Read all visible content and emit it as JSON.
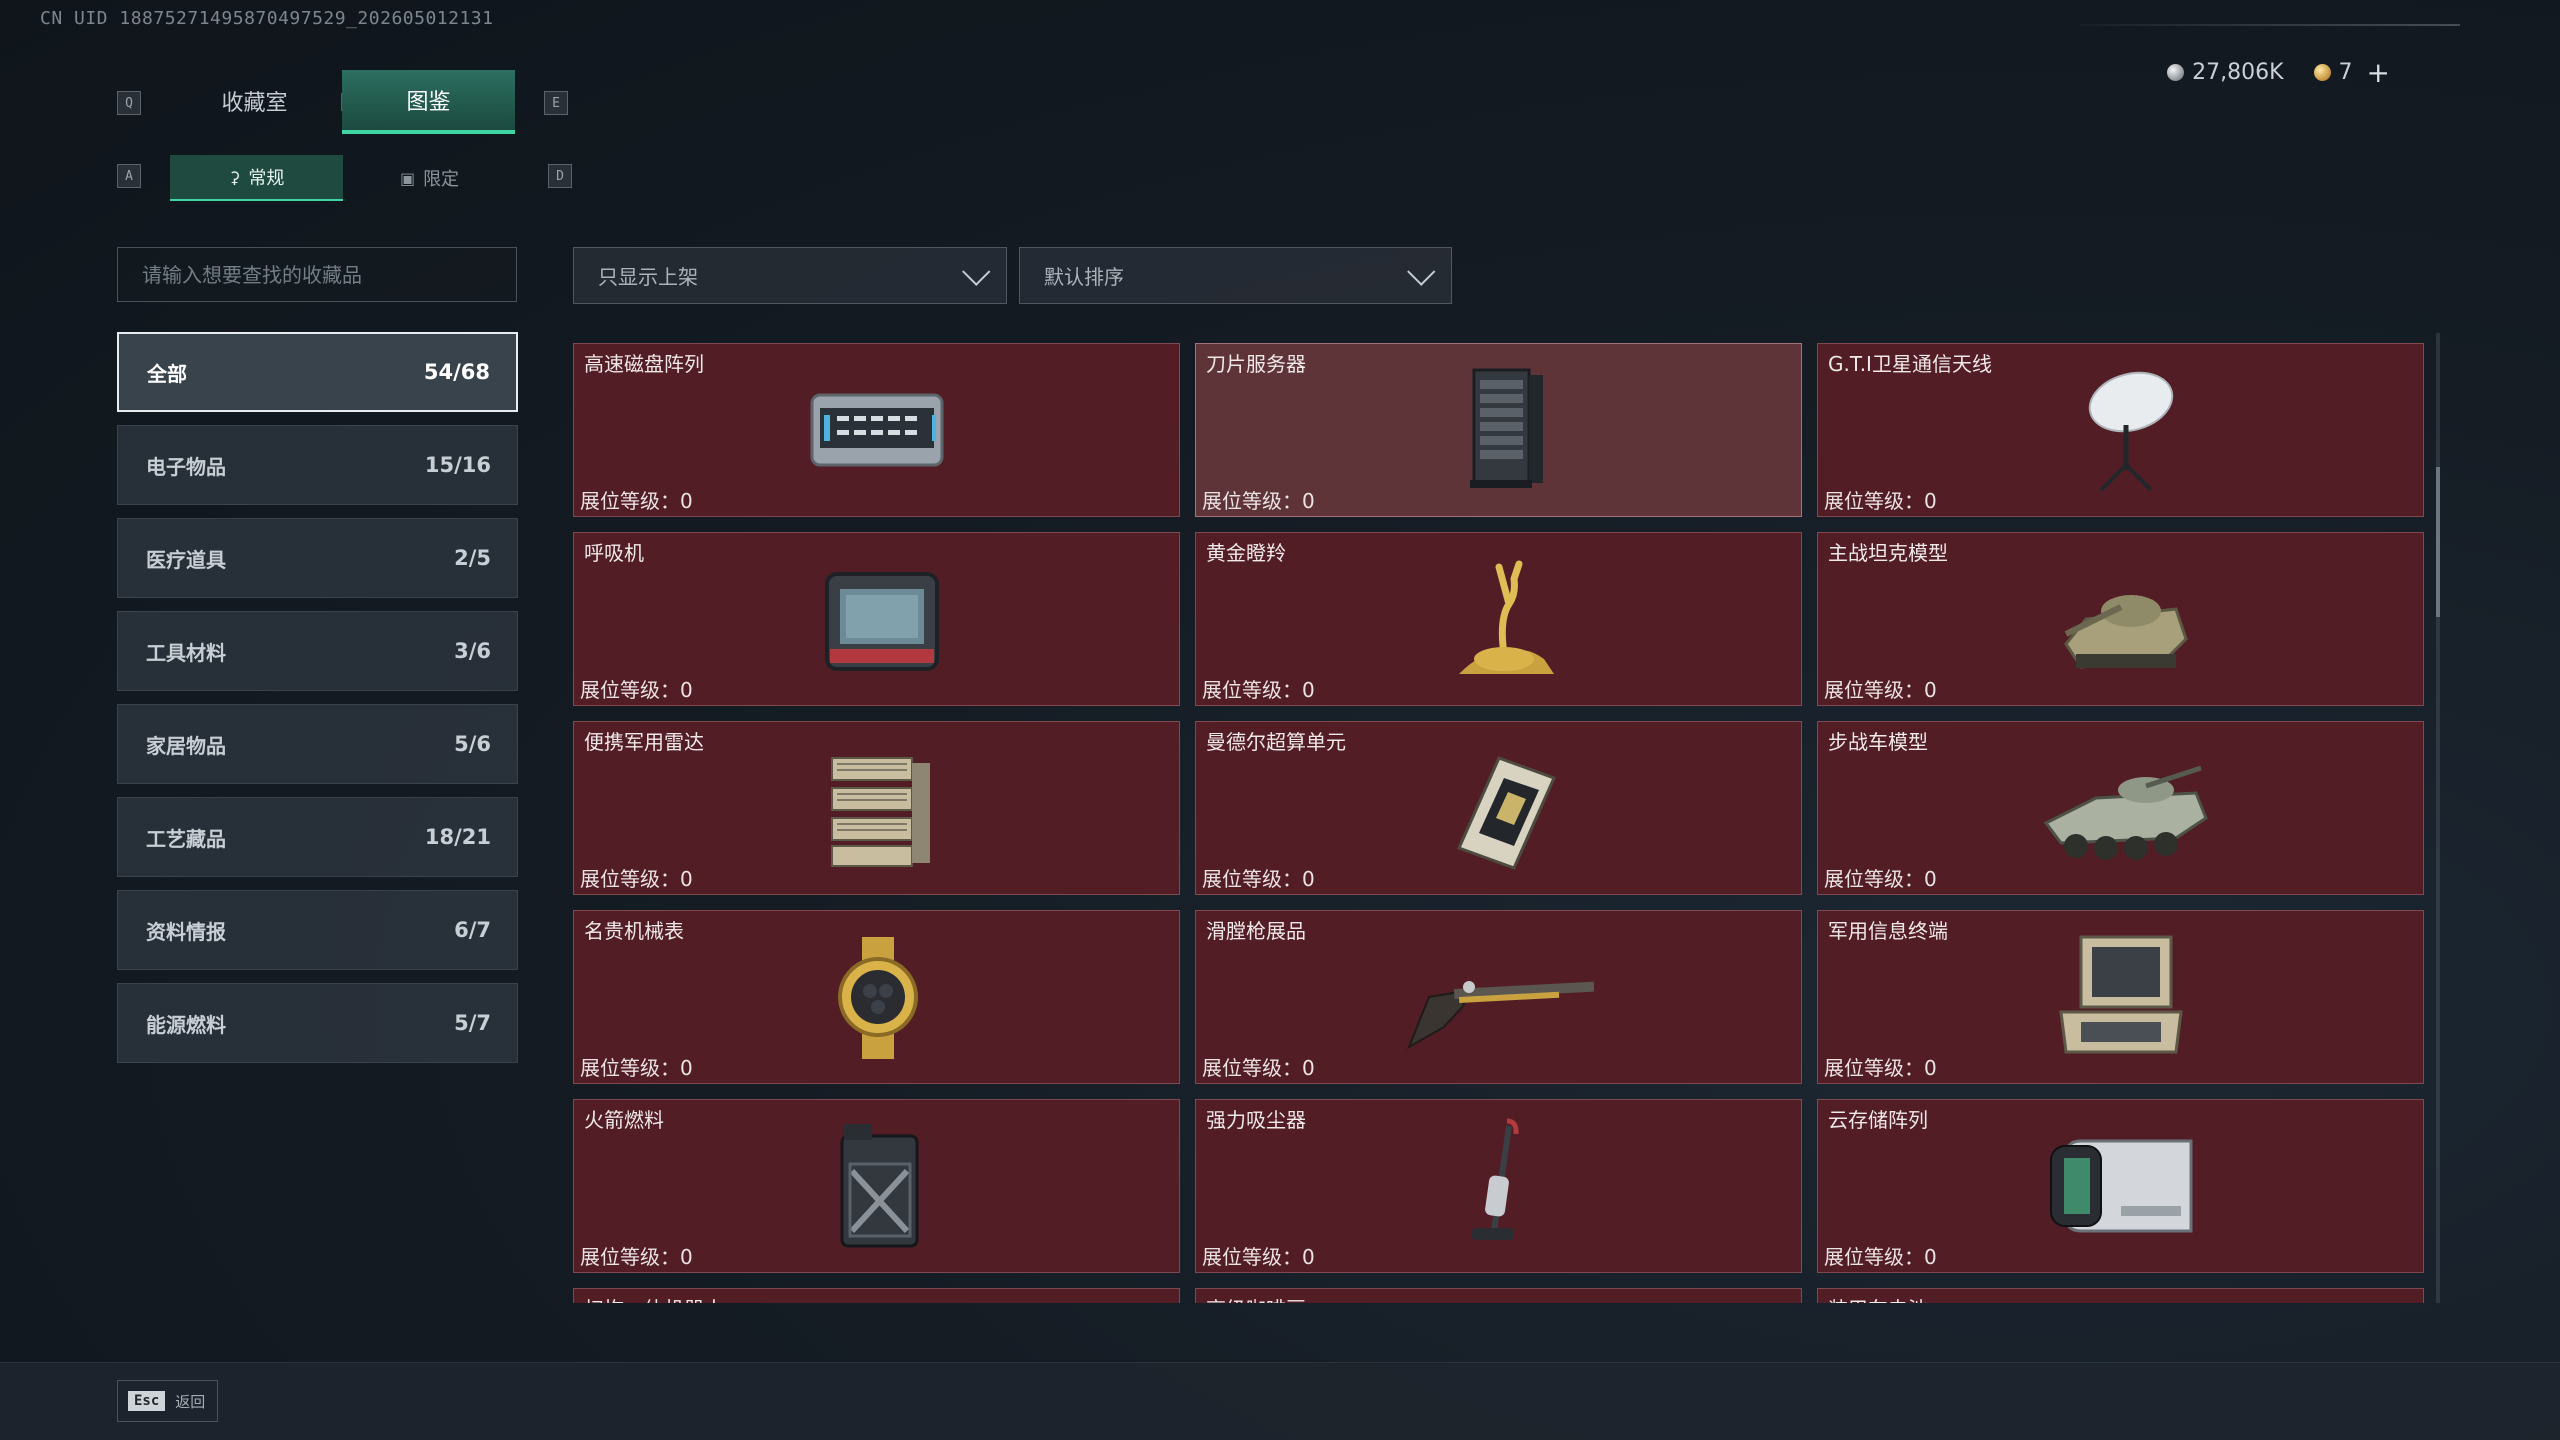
{
  "header": {
    "uid_text": "CN UID 18875271495870497529_202605012131",
    "currency": [
      {
        "icon": "silver-coin-icon",
        "value": "27,806K"
      },
      {
        "icon": "gold-coin-icon",
        "value": "7"
      }
    ],
    "plus": "+"
  },
  "keys": {
    "left_tab": "Q",
    "right_tab": "E",
    "left_sub": "A",
    "right_sub": "D"
  },
  "tabs": [
    {
      "label": "收藏室",
      "active": false
    },
    {
      "label": "图鉴",
      "active": true
    }
  ],
  "subtabs": [
    {
      "label": "常规",
      "icon": "flask-icon",
      "active": true
    },
    {
      "label": "限定",
      "icon": "image-icon",
      "active": false
    }
  ],
  "search": {
    "placeholder": "请输入想要查找的收藏品"
  },
  "filters": {
    "display": "只显示上架",
    "sort": "默认排序"
  },
  "categories": [
    {
      "label": "全部",
      "count": "54/68",
      "active": true
    },
    {
      "label": "电子物品",
      "count": "15/16"
    },
    {
      "label": "医疗道具",
      "count": "2/5"
    },
    {
      "label": "工具材料",
      "count": "3/6"
    },
    {
      "label": "家居物品",
      "count": "5/6"
    },
    {
      "label": "工艺藏品",
      "count": "18/21"
    },
    {
      "label": "资料情报",
      "count": "6/7"
    },
    {
      "label": "能源燃料",
      "count": "5/7"
    }
  ],
  "items": [
    {
      "name": "高速磁盘阵列",
      "level": "展位等级：0",
      "icon": "disk-array-icon"
    },
    {
      "name": "刀片服务器",
      "level": "展位等级：0",
      "icon": "server-icon",
      "highlight": true
    },
    {
      "name": "G.T.I卫星通信天线",
      "level": "展位等级：0",
      "icon": "satellite-dish-icon"
    },
    {
      "name": "呼吸机",
      "level": "展位等级：0",
      "icon": "ventilator-icon"
    },
    {
      "name": "黄金瞪羚",
      "level": "展位等级：0",
      "icon": "gazelle-statue-icon"
    },
    {
      "name": "主战坦克模型",
      "level": "展位等级：0",
      "icon": "tank-model-icon"
    },
    {
      "name": "便携军用雷达",
      "level": "展位等级：0",
      "icon": "radar-icon"
    },
    {
      "name": "曼德尔超算单元",
      "level": "展位等级：0",
      "icon": "supercomputer-unit-icon"
    },
    {
      "name": "步战车模型",
      "level": "展位等级：0",
      "icon": "ifv-model-icon"
    },
    {
      "name": "名贵机械表",
      "level": "展位等级：0",
      "icon": "watch-icon"
    },
    {
      "name": "滑膛枪展品",
      "level": "展位等级：0",
      "icon": "musket-icon"
    },
    {
      "name": "军用信息终端",
      "level": "展位等级：0",
      "icon": "terminal-case-icon"
    },
    {
      "name": "火箭燃料",
      "level": "展位等级：0",
      "icon": "fuel-canister-icon"
    },
    {
      "name": "强力吸尘器",
      "level": "展位等级：0",
      "icon": "vacuum-icon"
    },
    {
      "name": "云存储阵列",
      "level": "展位等级：0",
      "icon": "cloud-storage-icon"
    },
    {
      "name": "扫拖一体机器人",
      "level": "",
      "icon": ""
    },
    {
      "name": "高级咖啡豆",
      "level": "",
      "icon": ""
    },
    {
      "name": "装甲车电池",
      "level": "",
      "icon": ""
    }
  ],
  "footer": {
    "esc_key": "Esc",
    "back_label": "返回"
  },
  "colors": {
    "accent": "#3fd6a4",
    "card_bg": "#521d24",
    "card_border": "#7f4a4f"
  }
}
